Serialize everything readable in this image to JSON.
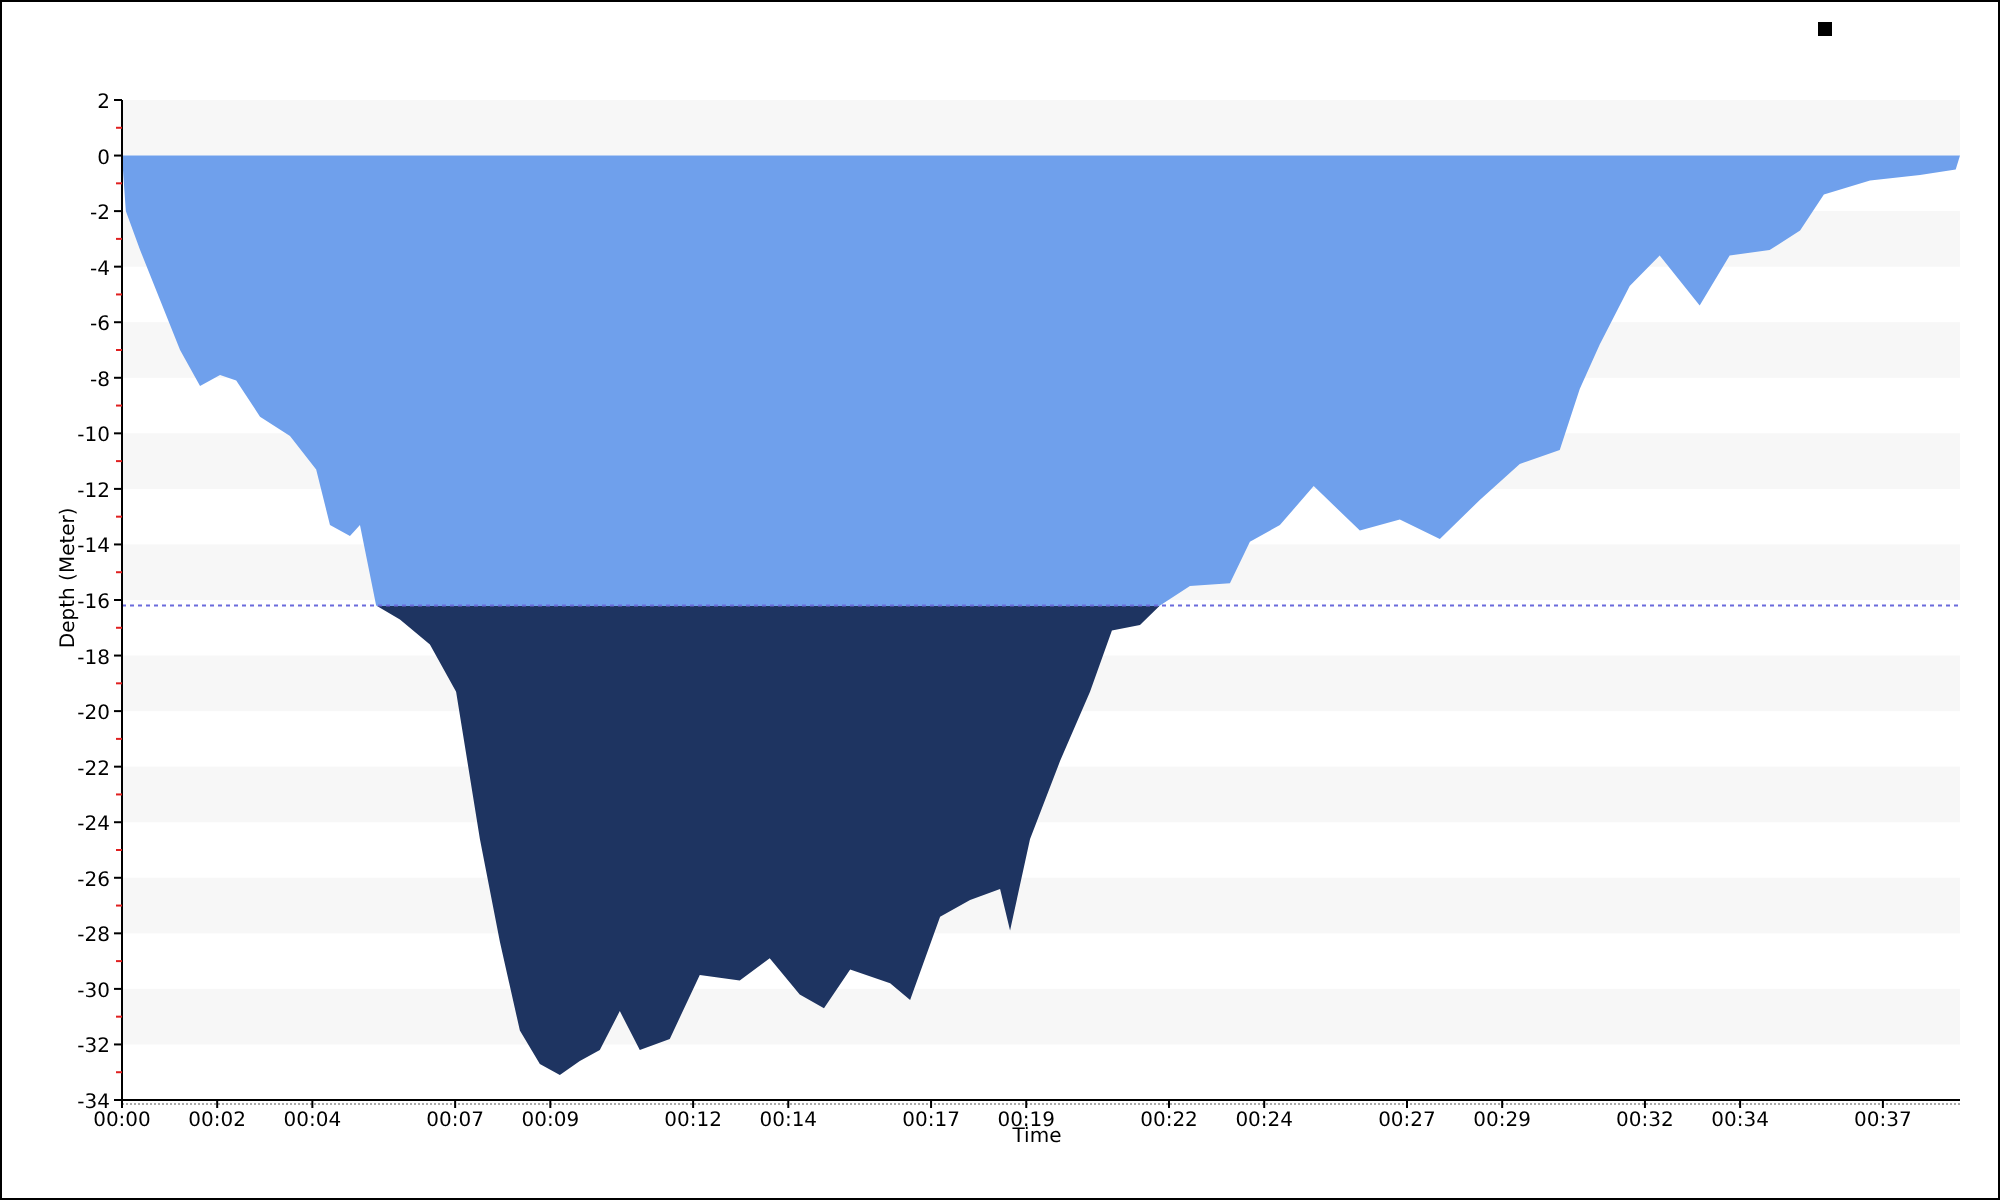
{
  "chart_data": {
    "type": "area",
    "xlabel": "Time",
    "ylabel": "Depth (Meter)",
    "x": [
      0,
      0.08,
      0.38,
      0.8,
      1.22,
      1.64,
      2.06,
      2.4,
      2.9,
      3.53,
      4.08,
      4.37,
      4.79,
      5.0,
      5.34,
      5.84,
      6.47,
      7.02,
      7.52,
      7.94,
      8.36,
      8.78,
      9.2,
      9.62,
      10.04,
      10.46,
      10.88,
      11.51,
      12.14,
      12.98,
      13.61,
      14.24,
      14.75,
      15.3,
      16.14,
      16.56,
      17.19,
      17.82,
      18.45,
      18.66,
      19.08,
      19.71,
      20.34,
      20.8,
      21.39,
      21.81,
      22.44,
      23.28,
      23.7,
      24.33,
      25.04,
      26.01,
      26.85,
      27.69,
      28.53,
      29.37,
      30.21,
      30.63,
      31.05,
      31.68,
      32.31,
      33.15,
      33.78,
      34.62,
      35.26,
      35.76,
      36.73,
      37.78,
      38.53,
      38.62
    ],
    "series": [
      {
        "color": "#6fa0ec",
        "values": [
          0,
          -2,
          -3.4,
          -5.2,
          -7,
          -8.3,
          -7.9,
          -8.1,
          -9.4,
          -10.1,
          -11.3,
          -13.3,
          -13.7,
          -13.3,
          -16.2,
          -16.7,
          -17.6,
          -19.3,
          -24.6,
          -28.3,
          -31.5,
          -32.7,
          -33.1,
          -32.6,
          -32.2,
          -30.8,
          -32.2,
          -31.8,
          -29.5,
          -29.7,
          -28.9,
          -30.2,
          -30.7,
          -29.3,
          -29.8,
          -30.4,
          -27.4,
          -26.8,
          -26.4,
          -27.9,
          -24.6,
          -21.8,
          -19.3,
          -17.1,
          -16.9,
          -16.2,
          -15.5,
          -15.4,
          -13.9,
          -13.3,
          -11.9,
          -13.5,
          -13.1,
          -13.8,
          -12.4,
          -11.1,
          -10.6,
          -8.4,
          -6.8,
          -4.7,
          -3.6,
          -5.4,
          -3.6,
          -3.4,
          -2.7,
          -1.4,
          -0.9,
          -0.7,
          -0.5,
          0
        ]
      },
      {
        "color": "#6b6bdc",
        "values": [
          -16.2,
          -16.2,
          -16.2,
          -16.2,
          -16.2,
          -16.2,
          -16.2,
          -16.2,
          -16.2,
          -16.2,
          -16.2,
          -16.2,
          -16.2,
          -16.2,
          -16.2,
          -16.2,
          -16.2,
          -16.2,
          -16.2,
          -16.2,
          -16.2,
          -16.2,
          -16.2,
          -16.2,
          -16.2,
          -16.2,
          -16.2,
          -16.2,
          -16.2,
          -16.2,
          -16.2,
          -16.2,
          -16.2,
          -16.2,
          -16.2,
          -16.2,
          -16.2,
          -16.2,
          -16.2,
          -16.2,
          -16.2,
          -16.2,
          -16.2,
          -16.2,
          -16.2,
          -16.2,
          -16.2,
          -16.2,
          -16.2,
          -16.2,
          -16.2,
          -16.2,
          -16.2,
          -16.2,
          -16.2,
          -16.2,
          -16.2,
          -16.2,
          -16.2,
          -16.2,
          -16.2,
          -16.2,
          -16.2,
          -16.2,
          -16.2,
          -16.2,
          -16.2,
          -16.2,
          -16.2,
          -16.2
        ]
      }
    ],
    "xlim": [
      0,
      38.62
    ],
    "ylim": [
      -34,
      2
    ],
    "xticks": [
      {
        "value": 0,
        "label": "00:00"
      },
      {
        "value": 2,
        "label": "00:02"
      },
      {
        "value": 4,
        "label": "00:04"
      },
      {
        "value": 7,
        "label": "00:07"
      },
      {
        "value": 9,
        "label": "00:09"
      },
      {
        "value": 12,
        "label": "00:12"
      },
      {
        "value": 14,
        "label": "00:14"
      },
      {
        "value": 17,
        "label": "00:17"
      },
      {
        "value": 19,
        "label": "00:19"
      },
      {
        "value": 22,
        "label": "00:22"
      },
      {
        "value": 24,
        "label": "00:24"
      },
      {
        "value": 27,
        "label": "00:27"
      },
      {
        "value": 29,
        "label": "00:29"
      },
      {
        "value": 32,
        "label": "00:32"
      },
      {
        "value": 34,
        "label": "00:34"
      },
      {
        "value": 37,
        "label": "00:37"
      }
    ],
    "yticks": [
      2,
      0,
      -2,
      -4,
      -6,
      -8,
      -10,
      -12,
      -14,
      -16,
      -18,
      -20,
      -22,
      -24,
      -26,
      -28,
      -30,
      -32,
      -34
    ]
  }
}
